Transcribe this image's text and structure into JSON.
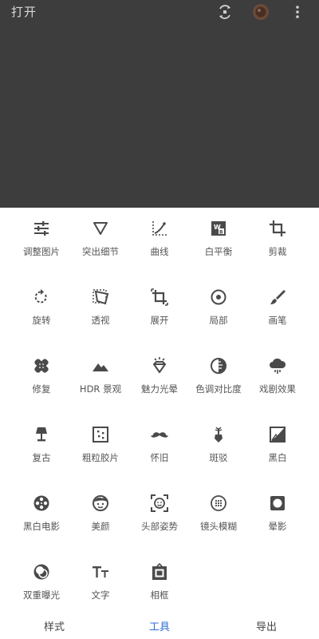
{
  "header": {
    "open_label": "打开",
    "icons": [
      "info-layers-icon",
      "avatar-icon",
      "more-vert-icon"
    ]
  },
  "tools": [
    {
      "label": "调整图片",
      "icon": "tune-sliders-icon"
    },
    {
      "label": "突出细节",
      "icon": "triangle-down-icon"
    },
    {
      "label": "曲线",
      "icon": "curves-icon"
    },
    {
      "label": "白平衡",
      "icon": "white-balance-icon"
    },
    {
      "label": "剪裁",
      "icon": "crop-icon"
    },
    {
      "label": "旋转",
      "icon": "rotate-icon"
    },
    {
      "label": "透视",
      "icon": "perspective-icon"
    },
    {
      "label": "展开",
      "icon": "expand-icon"
    },
    {
      "label": "局部",
      "icon": "selective-icon"
    },
    {
      "label": "画笔",
      "icon": "brush-icon"
    },
    {
      "label": "修复",
      "icon": "healing-bandage-icon"
    },
    {
      "label": "HDR 景观",
      "icon": "mountain-icon"
    },
    {
      "label": "魅力光晕",
      "icon": "diamond-glow-icon"
    },
    {
      "label": "色调对比度",
      "icon": "tonal-contrast-icon"
    },
    {
      "label": "戏剧效果",
      "icon": "drama-cloud-icon"
    },
    {
      "label": "复古",
      "icon": "lamp-icon"
    },
    {
      "label": "粗粒胶片",
      "icon": "grainy-film-icon"
    },
    {
      "label": "怀旧",
      "icon": "mustache-icon"
    },
    {
      "label": "斑驳",
      "icon": "grunge-guitar-icon"
    },
    {
      "label": "黑白",
      "icon": "black-white-icon"
    },
    {
      "label": "黑白电影",
      "icon": "film-reel-icon"
    },
    {
      "label": "美颜",
      "icon": "face-icon"
    },
    {
      "label": "头部姿势",
      "icon": "head-pose-icon"
    },
    {
      "label": "镜头模糊",
      "icon": "lens-blur-icon"
    },
    {
      "label": "晕影",
      "icon": "vignette-icon"
    },
    {
      "label": "双重曝光",
      "icon": "double-exposure-icon"
    },
    {
      "label": "文字",
      "icon": "text-icon"
    },
    {
      "label": "相框",
      "icon": "frame-icon"
    }
  ],
  "bottom_nav": {
    "styles": "样式",
    "tools": "工具",
    "export": "导出",
    "active": "tools",
    "active_color": "#2e6fd6"
  }
}
